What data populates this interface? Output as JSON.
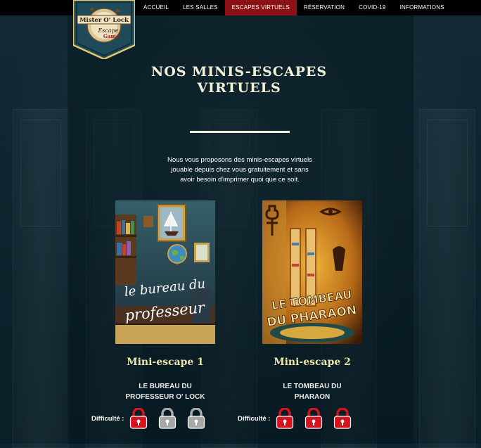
{
  "nav": {
    "items": [
      "ACCUEIL",
      "LES SALLES",
      "ESCAPES VIRTUELS",
      "RÉSERVATION",
      "COVID-19",
      "INFORMATIONS"
    ],
    "active_index": 2,
    "active_color": "#8c1116"
  },
  "logo": {
    "line1": "Mister O' Lock",
    "line2": "Escape",
    "line3": "Game"
  },
  "page": {
    "title_line1": "NOS MINIS-ESCAPES",
    "title_line2": "VIRTUELS",
    "intro_line1": "Nous vous proposons des minis-escapes virtuels",
    "intro_line2": "jouable depuis chez vous gratuitement et sans",
    "intro_line3": "avoir besoin d'imprimer quoi que ce soit."
  },
  "escapes": [
    {
      "heading": "Mini-escape 1",
      "name_line1": "LE BUREAU DU",
      "name_line2": "PROFESSEUR O' LOCK",
      "cover_text_line1": "le bureau du",
      "cover_text_line2": "professeur",
      "difficulty_label": "Difficulté :",
      "difficulty": 1,
      "difficulty_max": 3
    },
    {
      "heading": "Mini-escape 2",
      "name_line1": "LE TOMBEAU DU",
      "name_line2": "PHARAON",
      "cover_text_line1": "LE TOMBEAU",
      "cover_text_line2": "DU PHARAON",
      "difficulty_label": "Difficulté :",
      "difficulty": 3,
      "difficulty_max": 3
    }
  ],
  "colors": {
    "background": "#0f2630",
    "title": "#f3f0d8",
    "heading": "#e9e3a8",
    "lock_active": "#d3141f",
    "lock_inactive": "#a7a7a7"
  }
}
